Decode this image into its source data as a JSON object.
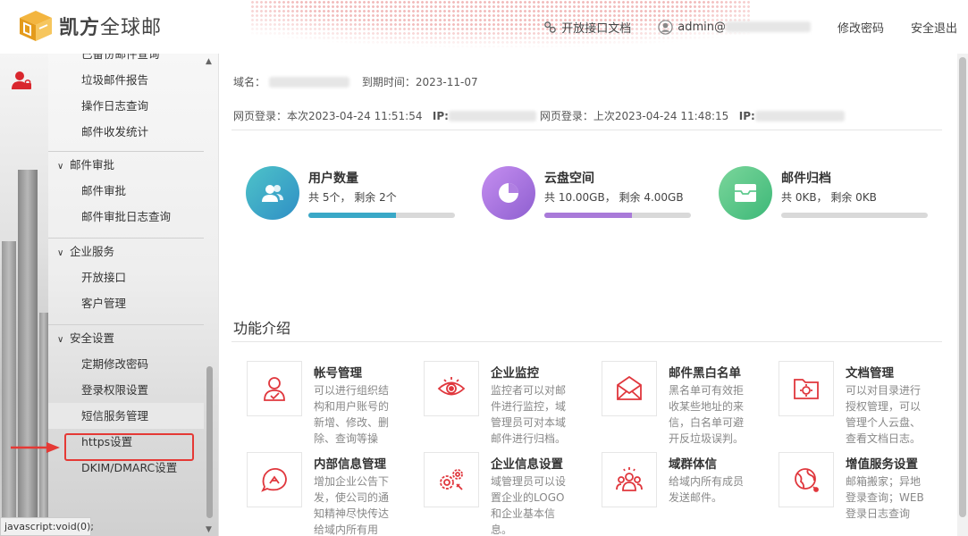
{
  "header": {
    "brand_bold": "凯方",
    "brand_rest": "全球邮",
    "api_doc": "开放接口文档",
    "user_prefix": "admin@",
    "change_password": "修改密码",
    "logout": "安全退出"
  },
  "sidebar": {
    "partial_top": "已备份邮件查询",
    "items_a": [
      "垃圾邮件报告",
      "操作日志查询",
      "邮件收发统计"
    ],
    "group_audit": "邮件审批",
    "items_audit": [
      "邮件审批",
      "邮件审批日志查询"
    ],
    "group_enterprise": "企业服务",
    "items_enterprise": [
      "开放接口",
      "客户管理"
    ],
    "group_security": "安全设置",
    "items_security": [
      "定期修改密码",
      "登录权限设置",
      "短信服务管理",
      "https设置",
      "DKIM/DMARC设置"
    ]
  },
  "statusbar": "javascript:void(0);",
  "info": {
    "domain_label": "域名：",
    "expire_label": "到期时间：",
    "expire_date": "2023-11-07",
    "login_now_label": "网页登录：本次",
    "login_now_time": "2023-04-24 11:51:54",
    "ip_label": "IP:",
    "login_last_label": "网页登录：上次",
    "login_last_time": "2023-04-24 11:48:15"
  },
  "stats": [
    {
      "title": "用户数量",
      "sub": "共 5个， 剩余 2个",
      "progress": 0.6,
      "color": "#3aa8c7"
    },
    {
      "title": "云盘空间",
      "sub": "共 10.00GB， 剩余 4.00GB",
      "progress": 0.6,
      "color": "#a97ad9"
    },
    {
      "title": "邮件归档",
      "sub": "共 0KB， 剩余 0KB",
      "progress": 0.0,
      "color": "#5ec98e"
    }
  ],
  "features_title": "功能介绍",
  "features": [
    {
      "title": "帐号管理",
      "desc": "可以进行组织结构和用户账号的新增、修改、删除、查询等操",
      "icon": "account-icon"
    },
    {
      "title": "企业监控",
      "desc": "监控者可以对邮件进行监控，域管理员可对本域邮件进行归档。",
      "icon": "eye-icon"
    },
    {
      "title": "邮件黑白名单",
      "desc": "黑名单可有效拒收某些地址的来信，白名单可避开反垃圾误判。",
      "icon": "envelope-icon"
    },
    {
      "title": "文档管理",
      "desc": "可以对目录进行授权管理，可以管理个人云盘、查看文档日志。",
      "icon": "folder-gear-icon"
    },
    {
      "title": "内部信息管理",
      "desc": "增加企业公告下发，使公司的通知精神尽快传达给域内所有用",
      "icon": "chat-icon"
    },
    {
      "title": "企业信息设置",
      "desc": "域管理员可以设置企业的LOGO和企业基本信息。",
      "icon": "gears-icon"
    },
    {
      "title": "域群体信",
      "desc": "给域内所有成员发送邮件。",
      "icon": "group-icon"
    },
    {
      "title": "增值服务设置",
      "desc": "邮箱搬家；异地登录查询；WEB登录日志查询",
      "icon": "globe-icon"
    }
  ]
}
